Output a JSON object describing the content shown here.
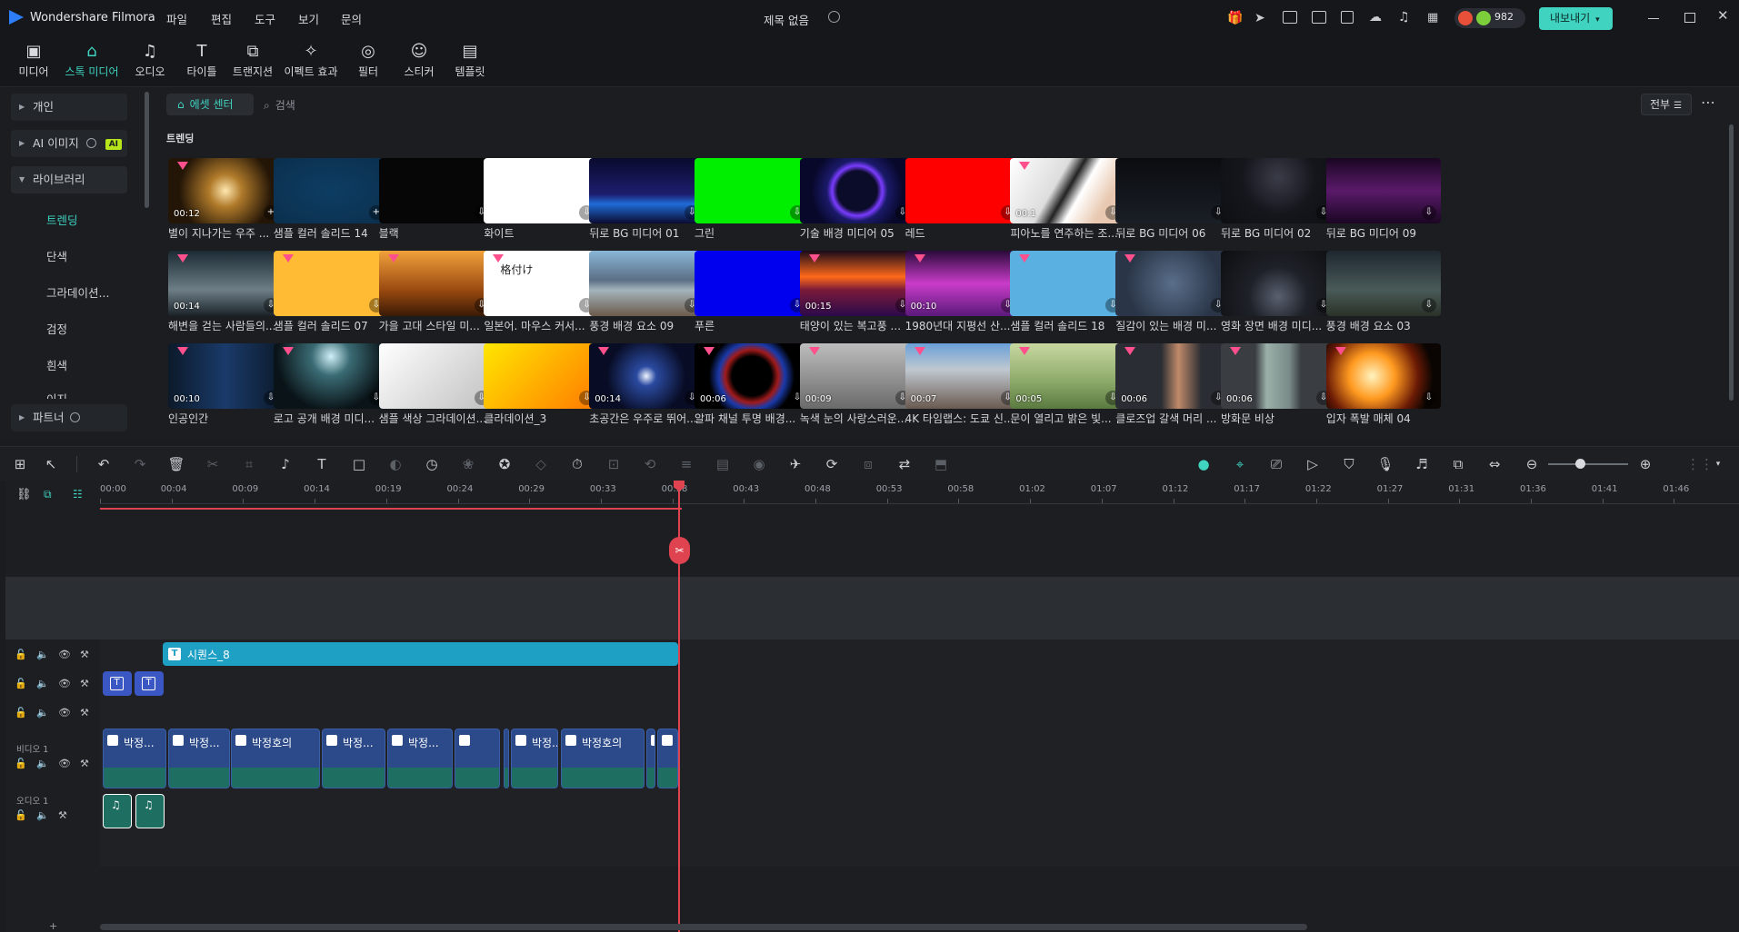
{
  "app": {
    "name": "Wondershare Filmora",
    "menu": [
      "파일",
      "편집",
      "도구",
      "보기",
      "문의"
    ],
    "project_title": "제목 없음",
    "credits": "982",
    "export_label": "내보내기",
    "accent": "#3fd3c0"
  },
  "toolbar": [
    {
      "label": "미디어",
      "icon": "media-icon"
    },
    {
      "label": "스톡 미디어",
      "icon": "stock-media-icon"
    },
    {
      "label": "오디오",
      "icon": "audio-icon"
    },
    {
      "label": "타이틀",
      "icon": "title-icon"
    },
    {
      "label": "트랜지션",
      "icon": "transition-icon"
    },
    {
      "label": "이펙트 효과",
      "icon": "effects-icon"
    },
    {
      "label": "필터",
      "icon": "filter-icon"
    },
    {
      "label": "스티커",
      "icon": "sticker-icon"
    },
    {
      "label": "템플릿",
      "icon": "template-icon"
    }
  ],
  "sidebar": {
    "items": [
      "개인",
      "AI 이미지",
      "라이브러리"
    ],
    "ai_badge": "AI",
    "library_subitems": [
      "트렌딩",
      "단색",
      "그라데이션...",
      "검정",
      "흰색",
      "이지"
    ],
    "footer": "파트너"
  },
  "assets": {
    "tab_label": "에셋 센터",
    "search_placeholder": "검색",
    "filter_label": "전부",
    "section_title": "트렌딩",
    "rows": [
      [
        {
          "title": "별이 지나가는 우주 ...",
          "dur": "00:12"
        },
        {
          "title": "샘플 컬러 솔리드 14",
          "dur": ""
        },
        {
          "title": "블랙",
          "dur": ""
        },
        {
          "title": "화이트",
          "dur": ""
        },
        {
          "title": "뒤로 BG 미디어 01",
          "dur": ""
        },
        {
          "title": "그린",
          "dur": ""
        },
        {
          "title": "기술 배경 미디어 05",
          "dur": ""
        },
        {
          "title": "레드",
          "dur": ""
        },
        {
          "title": "피아노를 연주하는 조...",
          "dur": "00:1"
        },
        {
          "title": "뒤로 BG 미디어 06",
          "dur": ""
        },
        {
          "title": "뒤로 BG 미디어 02",
          "dur": ""
        },
        {
          "title": "뒤로 BG 미디어 09",
          "dur": ""
        }
      ],
      [
        {
          "title": "해변을 걷는 사람들의...",
          "dur": "00:14"
        },
        {
          "title": "샘플 컬러 솔리드 07",
          "dur": ""
        },
        {
          "title": "가을 고대 스타일 미...",
          "dur": ""
        },
        {
          "title": "일본어. 마우스 커서...",
          "dur": "",
          "overlay": "格付け"
        },
        {
          "title": "풍경 배경 요소 09",
          "dur": ""
        },
        {
          "title": "푸른",
          "dur": ""
        },
        {
          "title": "태양이 있는 복고풍 ...",
          "dur": "00:15"
        },
        {
          "title": "1980년대 지평선 산...",
          "dur": "00:10"
        },
        {
          "title": "샘플 컬러 솔리드 18",
          "dur": ""
        },
        {
          "title": "질감이 있는 배경 미...",
          "dur": ""
        },
        {
          "title": "영화 장면 배경 미디...",
          "dur": ""
        },
        {
          "title": "풍경 배경 요소 03",
          "dur": ""
        }
      ],
      [
        {
          "title": "인공인간",
          "dur": "00:10"
        },
        {
          "title": "로고 공개 배경 미디...",
          "dur": ""
        },
        {
          "title": "샘플 색상 그라데이션...",
          "dur": ""
        },
        {
          "title": "클라데이션_3",
          "dur": ""
        },
        {
          "title": "초공간은 우주로 뛰어...",
          "dur": "00:14"
        },
        {
          "title": "알파 채널 투명 배경...",
          "dur": "00:06"
        },
        {
          "title": "녹색 눈의 사랑스러운...",
          "dur": "00:09"
        },
        {
          "title": "4K 타임랩스: 도쿄 신...",
          "dur": "00:07"
        },
        {
          "title": "문이 열리고 밝은 빛...",
          "dur": "00:05"
        },
        {
          "title": "클로즈업 갈색 머리 ...",
          "dur": "00:06"
        },
        {
          "title": "방화문 비상",
          "dur": "00:06"
        },
        {
          "title": "입자 폭발 매체 04",
          "dur": ""
        }
      ]
    ]
  },
  "timeline": {
    "ticks": [
      "00:00",
      "00:04",
      "00:09",
      "00:14",
      "00:19",
      "00:24",
      "00:29",
      "00:33",
      "00:38",
      "00:43",
      "00:48",
      "00:53",
      "00:58",
      "01:02",
      "01:07",
      "01:12",
      "01:17",
      "01:22",
      "01:27",
      "01:31",
      "01:36",
      "01:41",
      "01:46"
    ],
    "title_clip": "시퀀스_8",
    "track_labels": {
      "video": "비디오 1",
      "audio": "오디오 1"
    },
    "video_clip_label": "박정호의",
    "video_clip_short": "박정..."
  }
}
